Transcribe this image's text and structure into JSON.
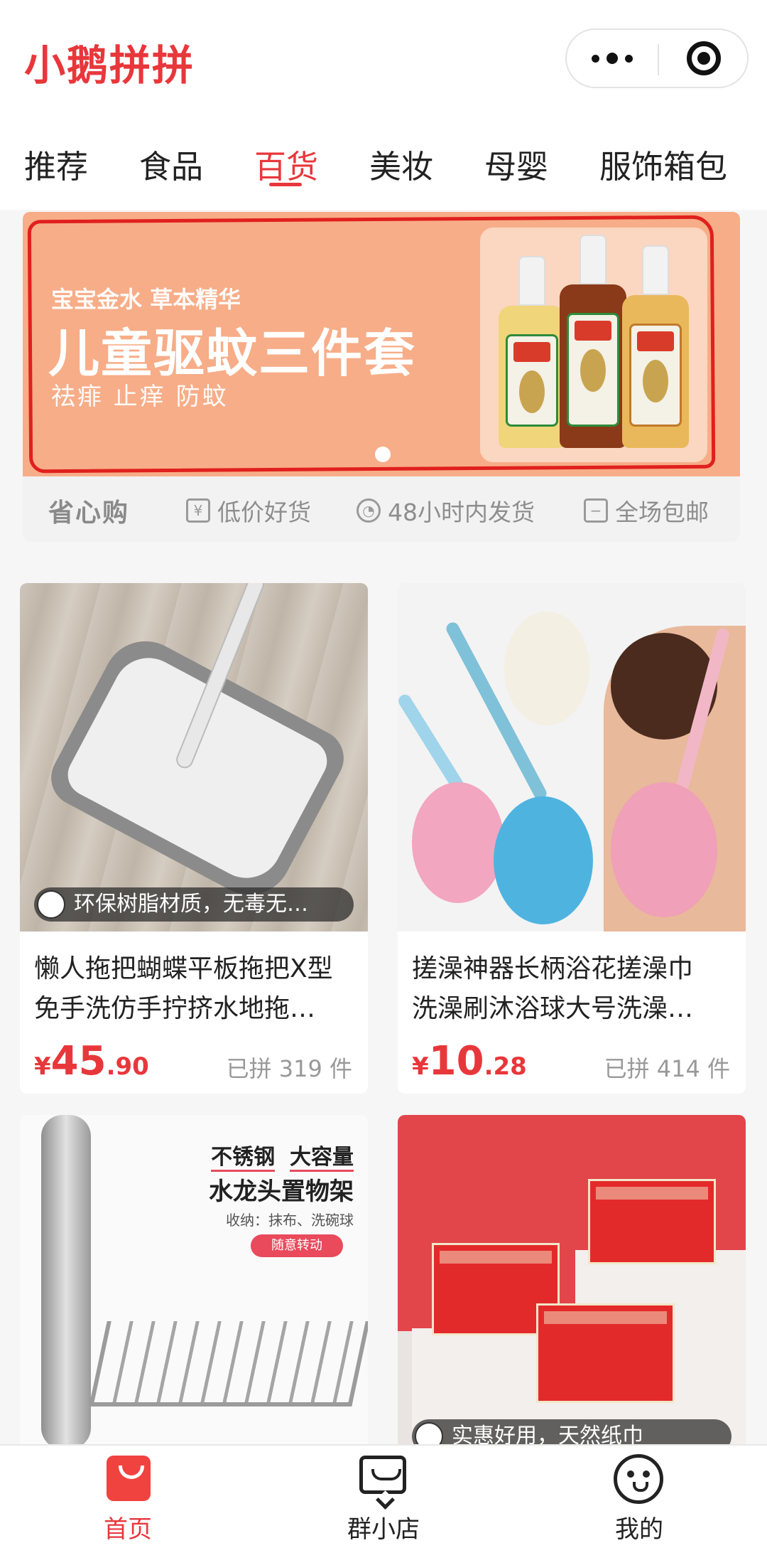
{
  "header": {
    "brand": "小鹅拼拼"
  },
  "tabs": [
    {
      "label": "推荐"
    },
    {
      "label": "食品"
    },
    {
      "label": "百货",
      "active": true
    },
    {
      "label": "美妆"
    },
    {
      "label": "母婴"
    },
    {
      "label": "服饰箱包"
    }
  ],
  "banner": {
    "subtitle": "宝宝金水 草本精华",
    "title": "儿童驱蚊三件套",
    "tags": "祛痱 止痒 防蚊",
    "annotation_color": "#e0201d"
  },
  "promise": {
    "title": "省心购",
    "items": [
      {
        "icon": "yen-icon",
        "label": "低价好货"
      },
      {
        "icon": "clock-icon",
        "label": "48小时内发货"
      },
      {
        "icon": "doc-icon",
        "label": "全场包邮"
      }
    ]
  },
  "products": [
    {
      "tag": "环保树脂材质，无毒无…",
      "title_line1": "懒人拖把蝴蝶平板拖把X型",
      "title_line2": "免手洗仿手拧挤水地拖…",
      "currency": "¥",
      "price_int": "45",
      "price_dec": ".90",
      "sold": "已拼 319 件"
    },
    {
      "title_line1": "搓澡神器长柄浴花搓澡巾",
      "title_line2": "洗澡刷沐浴球大号洗澡…",
      "currency": "¥",
      "price_int": "10",
      "price_dec": ".28",
      "sold": "已拼 414 件"
    },
    {
      "img_line1a": "不锈钢",
      "img_line1b": "大容量",
      "img_line2": "水龙头置物架",
      "img_line3": "收纳：抹布、洗碗球",
      "img_pill": "随意转动"
    },
    {
      "tag": "实惠好用，天然纸巾"
    }
  ],
  "tabbar": [
    {
      "label": "首页",
      "icon": "bag-icon",
      "active": true
    },
    {
      "label": "群小店",
      "icon": "shop-icon"
    },
    {
      "label": "我的",
      "icon": "penguin-icon"
    }
  ],
  "colors": {
    "accent": "#e8373b",
    "banner_bg": "#f7ad88"
  }
}
